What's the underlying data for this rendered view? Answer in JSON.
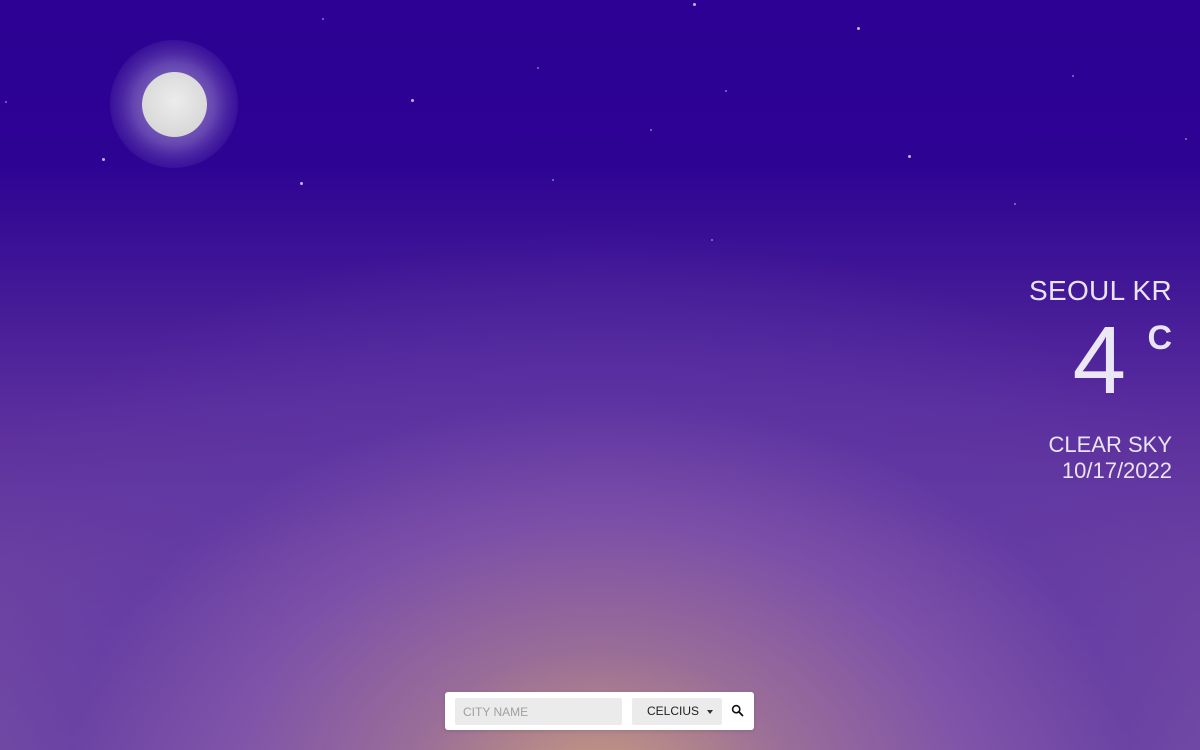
{
  "weather": {
    "location": "SEOUL KR",
    "temperature": "4",
    "unit_symbol": "C",
    "description": "CLEAR SKY",
    "date": "10/17/2022"
  },
  "search": {
    "city_placeholder": "CITY NAME",
    "city_value": "",
    "unit_selected": "CELCIUS",
    "search_icon": "search-icon"
  },
  "scene": {
    "moon_icon": "moon",
    "star_icon": "star",
    "colors": {
      "sky_top": "#2c0193",
      "sky_horizon": "#c9a07d",
      "moon": "#d9d9d9",
      "text": "#e9e4f2"
    }
  }
}
